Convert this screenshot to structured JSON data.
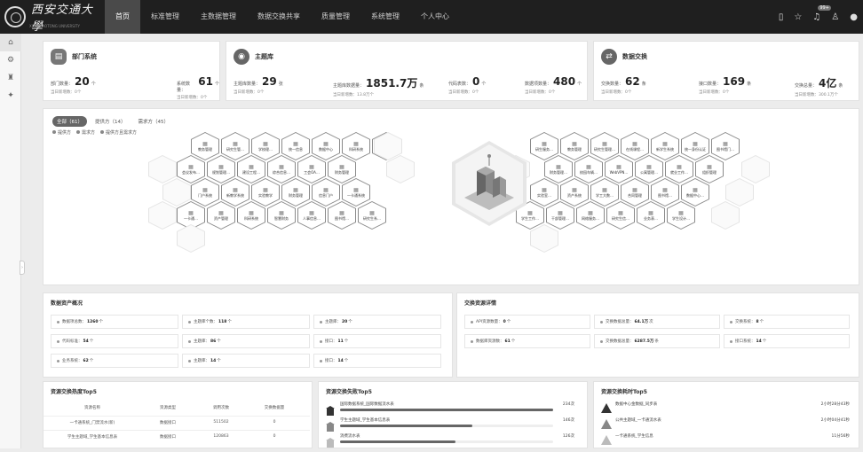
{
  "header": {
    "logo_text": "西安交通大學",
    "logo_subtitle": "XI'AN JIAOTONG UNIVERSITY",
    "nav": [
      "首页",
      "标准管理",
      "主数据管理",
      "数据交换共享",
      "质量管理",
      "系统管理",
      "个人中心"
    ],
    "active_nav": "首页",
    "notification_badge": "99+"
  },
  "sidebar": {
    "icons": [
      "home-icon",
      "settings-icon",
      "lock-icon",
      "star-icon"
    ]
  },
  "stats": {
    "dept": {
      "title": "部门系统",
      "metrics": [
        {
          "label": "部门数量：",
          "value": "20",
          "unit": "个",
          "sub": "当日新增数：0个"
        },
        {
          "label": "系统数量：",
          "value": "61",
          "unit": "个",
          "sub": "当日新增数：0个"
        }
      ]
    },
    "master": {
      "title": "主题库",
      "metrics": [
        {
          "label": "主题库数量：",
          "value": "29",
          "unit": "张",
          "sub": "当日新增数：0个"
        },
        {
          "label": "主题库数据量：",
          "value": "1851.7万",
          "unit": "条",
          "sub": "当日新增数：13.8万个"
        },
        {
          "label": "代码表数：",
          "value": "0",
          "unit": "个",
          "sub": "当日新增数：0个"
        },
        {
          "label": "数据项数量：",
          "value": "480",
          "unit": "个",
          "sub": "当日新增数：0个"
        }
      ]
    },
    "exchange": {
      "title": "数据交换",
      "metrics": [
        {
          "label": "交换数量：",
          "value": "62",
          "unit": "条",
          "sub": "当日新增数：0个"
        },
        {
          "label": "接口数量：",
          "value": "169",
          "unit": "条",
          "sub": "当日新增数：0个"
        },
        {
          "label": "交换总量：",
          "value": "4亿",
          "unit": "条",
          "sub": "当日新增数：300.1万个"
        }
      ]
    }
  },
  "filter": {
    "tabs": [
      "全部（61）",
      "提供方（14）",
      "需求方（45）"
    ],
    "legend": [
      "提供方",
      "需求方",
      "提供方且需求方"
    ]
  },
  "hex_left": [
    "教务管理",
    "研究生管…",
    "学校理…",
    "统一信息",
    "数据中心",
    "科研系统",
    "数据中心…",
    "会议发布…",
    "规划管理…",
    "建设工程…",
    "综合信息…",
    "工会OA…",
    "财务管理",
    "门户系统",
    "新教学系统",
    "实验教学",
    "财务管理",
    "信息门户",
    "一卡通系统",
    "一卡通…",
    "资产管理",
    "科研系统",
    "智慧财务",
    "人事信息…",
    "图书馆…",
    "研究生系…"
  ],
  "hex_right": [
    "研生服务…",
    "教务管理",
    "研究生管理…",
    "在线课程…",
    "新学生系统",
    "统一身份认证",
    "图书馆门…",
    "财务管理…",
    "校园车辆…",
    "WebVPN…",
    "公寓管理…",
    "就业工作…",
    "组织管理",
    "实验室…",
    "资产系统",
    "学工大数…",
    "合同管理",
    "图书馆…",
    "数据中心…",
    "学生工作…",
    "干部管理…",
    "网络服务…",
    "研究生信…",
    "业务表…",
    "学生设计…"
  ],
  "assets": {
    "title": "数据资产概况",
    "rows": [
      [
        {
          "k": "数据项总数：",
          "v": "1260",
          "u": "个"
        },
        {
          "k": "主题库个数：",
          "v": "118",
          "u": "个"
        },
        {
          "k": "主题库：",
          "v": "20",
          "u": "个"
        }
      ],
      [
        {
          "k": "代码标准：",
          "v": "54",
          "u": "个"
        },
        {
          "k": "主题库：",
          "v": "86",
          "u": "个"
        },
        {
          "k": "接口：",
          "v": "11",
          "u": "个"
        }
      ],
      [
        {
          "k": "业务系统：",
          "v": "62",
          "u": "个"
        },
        {
          "k": "主题库：",
          "v": "14",
          "u": "个"
        },
        {
          "k": "接口：",
          "v": "14",
          "u": "个"
        }
      ]
    ]
  },
  "exchange_detail": {
    "title": "交换资源详情",
    "rows": [
      [
        {
          "k": "API资源数量：",
          "v": "0",
          "u": "个"
        },
        {
          "k": "交换数据总量：",
          "v": "64.1万",
          "u": "次"
        },
        {
          "k": "交换系统：",
          "v": "8",
          "u": "个"
        }
      ],
      [
        {
          "k": "数据库资源数：",
          "v": "61",
          "u": "个"
        },
        {
          "k": "交换数据总量：",
          "v": "6287.5万",
          "u": "条"
        },
        {
          "k": "接口系统：",
          "v": "14",
          "u": "个"
        }
      ]
    ]
  },
  "top_hot": {
    "title": "资源交换热度Top5",
    "columns": [
      "资源名称",
      "资源类型",
      "调用次数",
      "交换数据量"
    ],
    "rows": [
      [
        "一卡通系统_门禁流水(新)",
        "数据接口",
        "511502",
        "0"
      ],
      [
        "学生主题域_学生基本信息表",
        "数据接口",
        "120863",
        "0"
      ]
    ]
  },
  "top_fail": {
    "title": "资源交换失败Top5",
    "items": [
      {
        "name": "国际数据系统_国际数据流水表",
        "value": "234次",
        "pct": 100
      },
      {
        "name": "学生主题域_学生基本信息表",
        "value": "146次",
        "pct": 62
      },
      {
        "name": "消费流水表",
        "value": "126次",
        "pct": 54
      }
    ]
  },
  "top_time": {
    "title": "资源交换耗时Top5",
    "items": [
      {
        "name": "数据中心金数据_同步表",
        "value": "2小时28分43秒"
      },
      {
        "name": "公共主题域_一卡通流水表",
        "value": "2小时04分41秒"
      },
      {
        "name": "一卡通系统_学生信息",
        "value": "11分56秒"
      }
    ]
  }
}
